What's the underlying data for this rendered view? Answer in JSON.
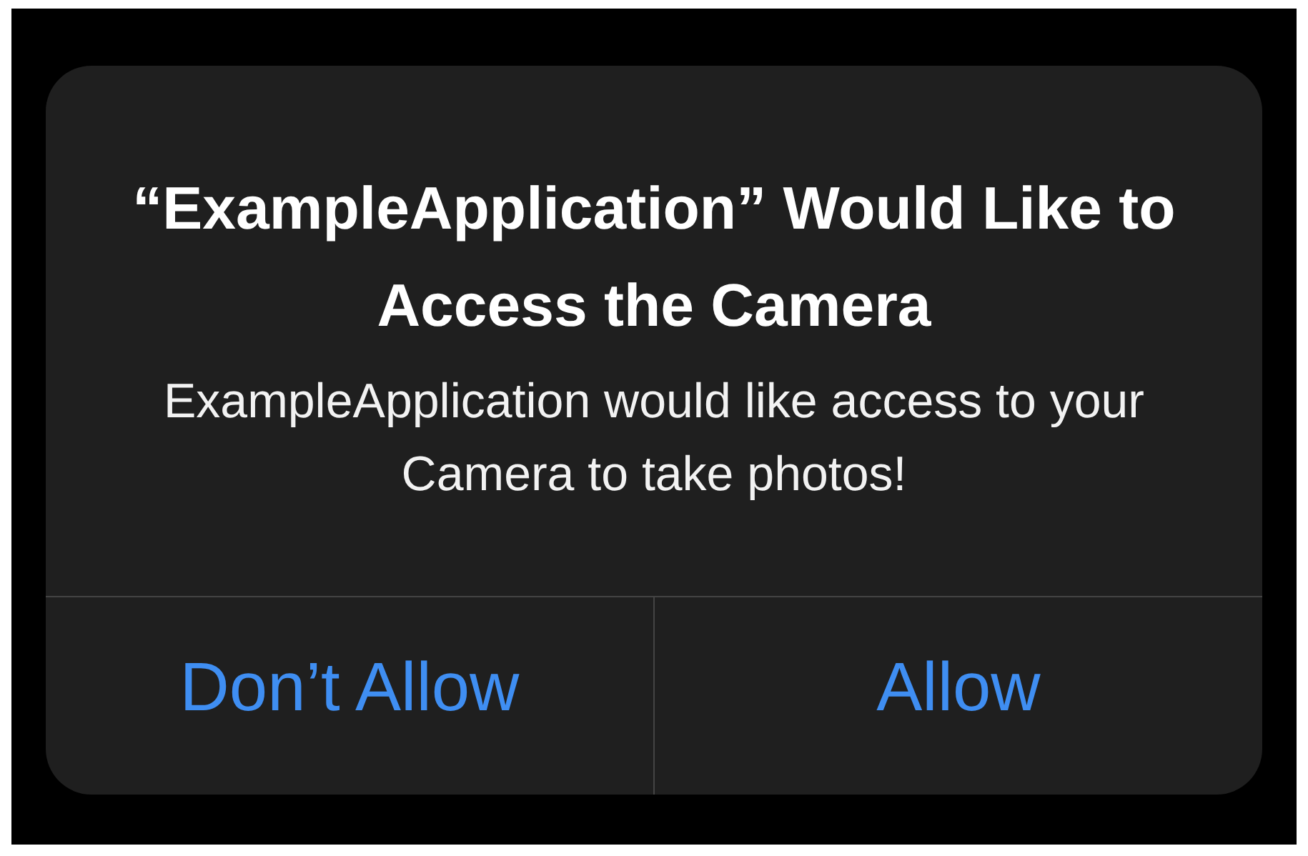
{
  "alert": {
    "title": "“ExampleApplication” Would Like to Access the Camera",
    "message": "ExampleApplication would like access to your Camera to take photos!",
    "buttons": [
      {
        "label": "Don’t Allow"
      },
      {
        "label": "Allow"
      }
    ]
  }
}
